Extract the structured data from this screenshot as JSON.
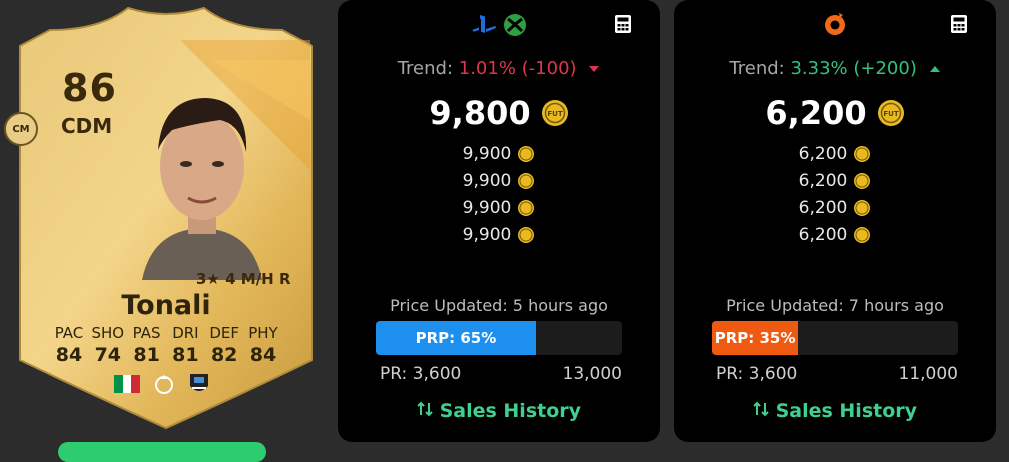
{
  "player": {
    "rating": "86",
    "position": "CDM",
    "alt_position": "CM",
    "skills": "3★ 4 M/H R",
    "name": "Tonali",
    "stat_labels": [
      "PAC",
      "SHO",
      "PAS",
      "DRI",
      "DEF",
      "PHY"
    ],
    "stat_values": [
      "84",
      "74",
      "81",
      "81",
      "82",
      "84"
    ],
    "icons": [
      "italy-flag-icon",
      "premier-league-icon",
      "newcastle-badge-icon"
    ]
  },
  "console": {
    "platform_icons": [
      "playstation-icon",
      "xbox-icon"
    ],
    "trend_label": "Trend:",
    "trend_value": "1.01% (-100)",
    "trend_direction": "down",
    "price": "9,800",
    "price_list": [
      "9,900",
      "9,900",
      "9,900",
      "9,900"
    ],
    "updated": "Price Updated: 5 hours ago",
    "prp_label": "PRP: 65%",
    "prp_fraction": 0.65,
    "pr_min": "PR: 3,600",
    "pr_max": "13,000",
    "sales_history": "Sales History"
  },
  "pc": {
    "platform_icons": [
      "origin-icon"
    ],
    "trend_label": "Trend:",
    "trend_value": "3.33% (+200)",
    "trend_direction": "up",
    "price": "6,200",
    "price_list": [
      "6,200",
      "6,200",
      "6,200",
      "6,200"
    ],
    "updated": "Price Updated: 7 hours ago",
    "prp_label": "PRP: 35%",
    "prp_fraction": 0.35,
    "pr_min": "PR: 3,600",
    "pr_max": "11,000",
    "sales_history": "Sales History"
  },
  "colors": {
    "trend_down": "#e0344e",
    "trend_up": "#35c17b",
    "console_bar": "#1d8fef",
    "pc_bar": "#f05a10",
    "sales_link": "#3fcf8e"
  }
}
